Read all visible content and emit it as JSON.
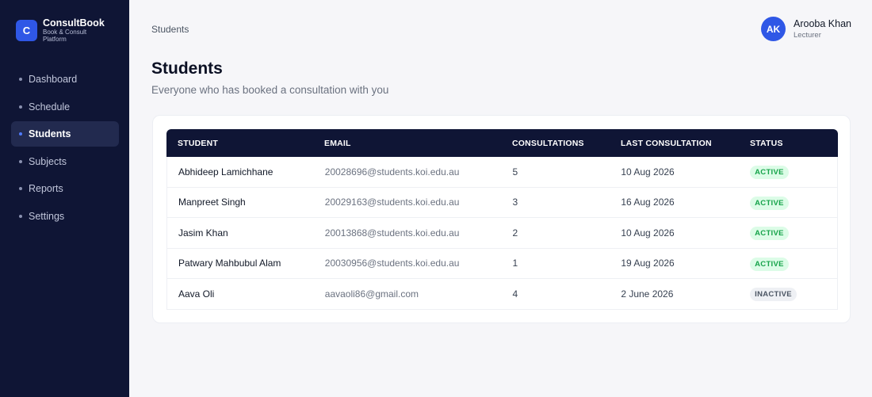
{
  "brand": {
    "logo_letter": "C",
    "name": "ConsultBook",
    "subtitle": "Book & Consult Platform"
  },
  "nav": [
    {
      "label": "Dashboard",
      "active": false
    },
    {
      "label": "Schedule",
      "active": false
    },
    {
      "label": "Students",
      "active": true
    },
    {
      "label": "Subjects",
      "active": false
    },
    {
      "label": "Reports",
      "active": false
    },
    {
      "label": "Settings",
      "active": false
    }
  ],
  "breadcrumb": "Students",
  "user": {
    "initials": "AK",
    "name": "Arooba Khan",
    "role": "Lecturer"
  },
  "page": {
    "title": "Students",
    "subtitle": "Everyone who has booked a consultation with you"
  },
  "table": {
    "headers": [
      "STUDENT",
      "EMAIL",
      "CONSULTATIONS",
      "LAST CONSULTATION",
      "STATUS"
    ],
    "rows": [
      {
        "student": "Abhideep Lamichhane",
        "email": "20028696@students.koi.edu.au",
        "consultations": "5",
        "last": "10 Aug 2026",
        "status": "ACTIVE"
      },
      {
        "student": "Manpreet Singh",
        "email": "20029163@students.koi.edu.au",
        "consultations": "3",
        "last": "16 Aug 2026",
        "status": "ACTIVE"
      },
      {
        "student": "Jasim Khan",
        "email": "20013868@students.koi.edu.au",
        "consultations": "2",
        "last": "10 Aug 2026",
        "status": "ACTIVE"
      },
      {
        "student": "Patwary Mahbubul Alam",
        "email": "20030956@students.koi.edu.au",
        "consultations": "1",
        "last": "19 Aug 2026",
        "status": "ACTIVE"
      },
      {
        "student": "Aava Oli",
        "email": "aavaoli86@gmail.com",
        "consultations": "4",
        "last": "2 June 2026",
        "status": "INACTIVE"
      }
    ]
  },
  "colors": {
    "sidebar": "#0f1535",
    "accent": "#2f57e6",
    "active_badge": "#16a34a"
  }
}
